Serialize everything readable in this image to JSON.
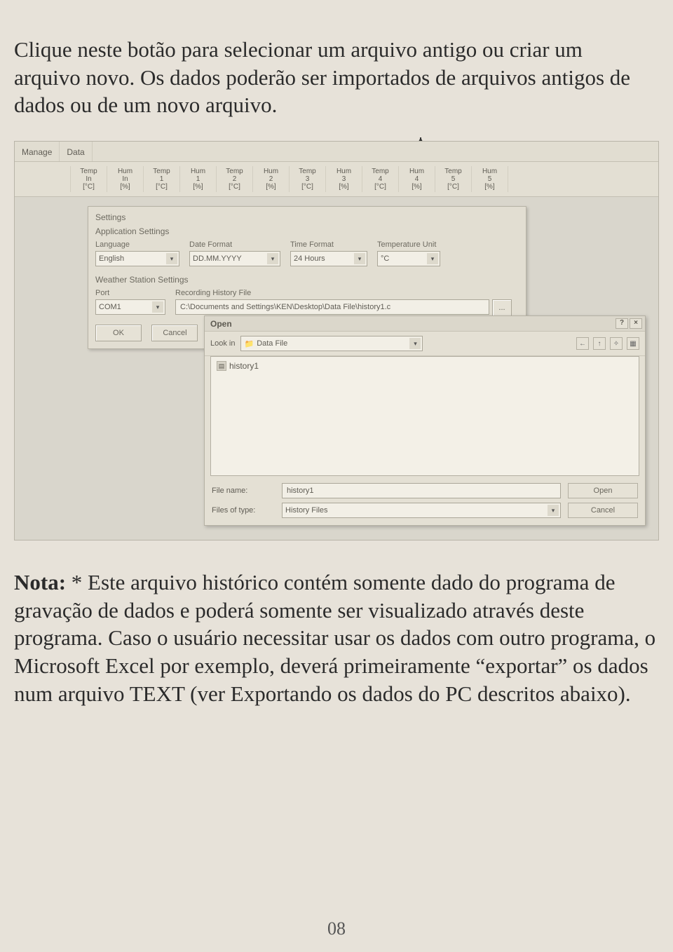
{
  "intro": "Clique neste botão para selecionar um arquivo antigo ou criar um arquivo novo. Os dados poderão ser importados de arquivos antigos de dados ou de um novo arquivo.",
  "tabs": {
    "tab1": "Manage",
    "tab2": "Data"
  },
  "headers": {
    "c0a": "",
    "c0b": "",
    "c1a": "Temp",
    "c1b": "In",
    "c1c": "[°C]",
    "c2a": "Hum",
    "c2b": "In",
    "c2c": "[%]",
    "c3a": "Temp",
    "c3b": "1",
    "c3c": "[°C]",
    "c4a": "Hum",
    "c4b": "1",
    "c4c": "[%]",
    "c5a": "Temp",
    "c5b": "2",
    "c5c": "[°C]",
    "c6a": "Hum",
    "c6b": "2",
    "c6c": "[%]",
    "c7a": "Temp",
    "c7b": "3",
    "c7c": "[°C]",
    "c8a": "Hum",
    "c8b": "3",
    "c8c": "[%]",
    "c9a": "Temp",
    "c9b": "4",
    "c9c": "[°C]",
    "c10a": "Hum",
    "c10b": "4",
    "c10c": "[%]",
    "c11a": "Temp",
    "c11b": "5",
    "c11c": "[°C]",
    "c12a": "Hum",
    "c12b": "5",
    "c12c": "[%]"
  },
  "settings": {
    "top_tab": "Settings",
    "app_section": "Application Settings",
    "lang_label": "Language",
    "lang_value": "English",
    "datefmt_label": "Date Format",
    "datefmt_value": "DD.MM.YYYY",
    "timefmt_label": "Time Format",
    "timefmt_value": "24 Hours",
    "tempunit_label": "Temperature Unit",
    "tempunit_value": "°C",
    "ws_section": "Weather Station Settings",
    "port_label": "Port",
    "port_value": "COM1",
    "histfile_label": "Recording History File",
    "histfile_value": "C:\\Documents and Settings\\KEN\\Desktop\\Data File\\history1.c",
    "ok_label": "OK",
    "cancel_label": "Cancel"
  },
  "open": {
    "title": "Open",
    "help_btn": "?",
    "close_btn": "×",
    "lookin_label": "Look in",
    "lookin_value": "Data File",
    "file1": "history1",
    "filename_label": "File name:",
    "filename_value": "history1",
    "filetype_label": "Files of type:",
    "filetype_value": "History Files",
    "open_btn": "Open",
    "cancel_btn": "Cancel",
    "tb_back": "←",
    "tb_up": "↑",
    "tb_new": "✧",
    "tb_views": "▦"
  },
  "note_bold": "Nota:",
  "note_body": " * Este arquivo histórico contém somente dado do programa de gravação de dados e poderá somente ser visualizado através deste programa. Caso o usuário necessitar usar os dados com outro programa, o Microsoft Excel por exemplo, deverá primeiramente “exportar” os dados num arquivo TEXT (ver Exportando os dados do PC descritos abaixo).",
  "page_number": "08"
}
